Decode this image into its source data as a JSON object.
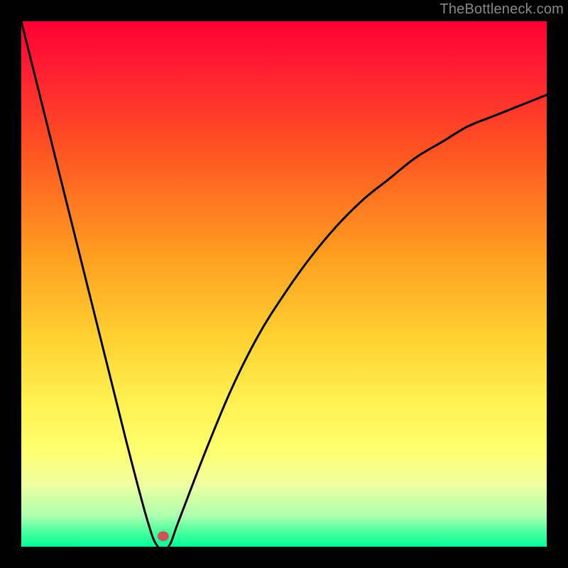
{
  "watermark": "TheBottleneck.com",
  "chart_data": {
    "type": "line",
    "title": "",
    "xlabel": "",
    "ylabel": "",
    "xlim": [
      0,
      100
    ],
    "ylim": [
      0,
      100
    ],
    "series": [
      {
        "name": "bottleneck-curve",
        "x": [
          0,
          5,
          10,
          15,
          20,
          24,
          26,
          28,
          30,
          35,
          40,
          45,
          50,
          55,
          60,
          65,
          70,
          75,
          80,
          85,
          90,
          95,
          100
        ],
        "values": [
          100,
          80,
          60,
          40,
          20,
          5,
          0,
          0,
          5,
          18,
          30,
          40,
          48,
          55,
          61,
          66,
          70,
          74,
          77,
          80,
          82,
          84,
          86
        ],
        "color": "#000000"
      }
    ],
    "marker": {
      "name": "optimal-point",
      "x": 27,
      "y": 2,
      "color": "#cc5555"
    },
    "background": {
      "gradient_stops": [
        {
          "offset": 0.0,
          "color": "#ff0033"
        },
        {
          "offset": 0.08,
          "color": "#ff1a33"
        },
        {
          "offset": 0.25,
          "color": "#ff5522"
        },
        {
          "offset": 0.45,
          "color": "#ffa020"
        },
        {
          "offset": 0.6,
          "color": "#ffd030"
        },
        {
          "offset": 0.72,
          "color": "#fff050"
        },
        {
          "offset": 0.82,
          "color": "#ffff70"
        },
        {
          "offset": 0.88,
          "color": "#f0ffa0"
        },
        {
          "offset": 0.94,
          "color": "#b0ffb0"
        },
        {
          "offset": 0.97,
          "color": "#50ffa0"
        },
        {
          "offset": 1.0,
          "color": "#00ff99"
        }
      ]
    }
  }
}
